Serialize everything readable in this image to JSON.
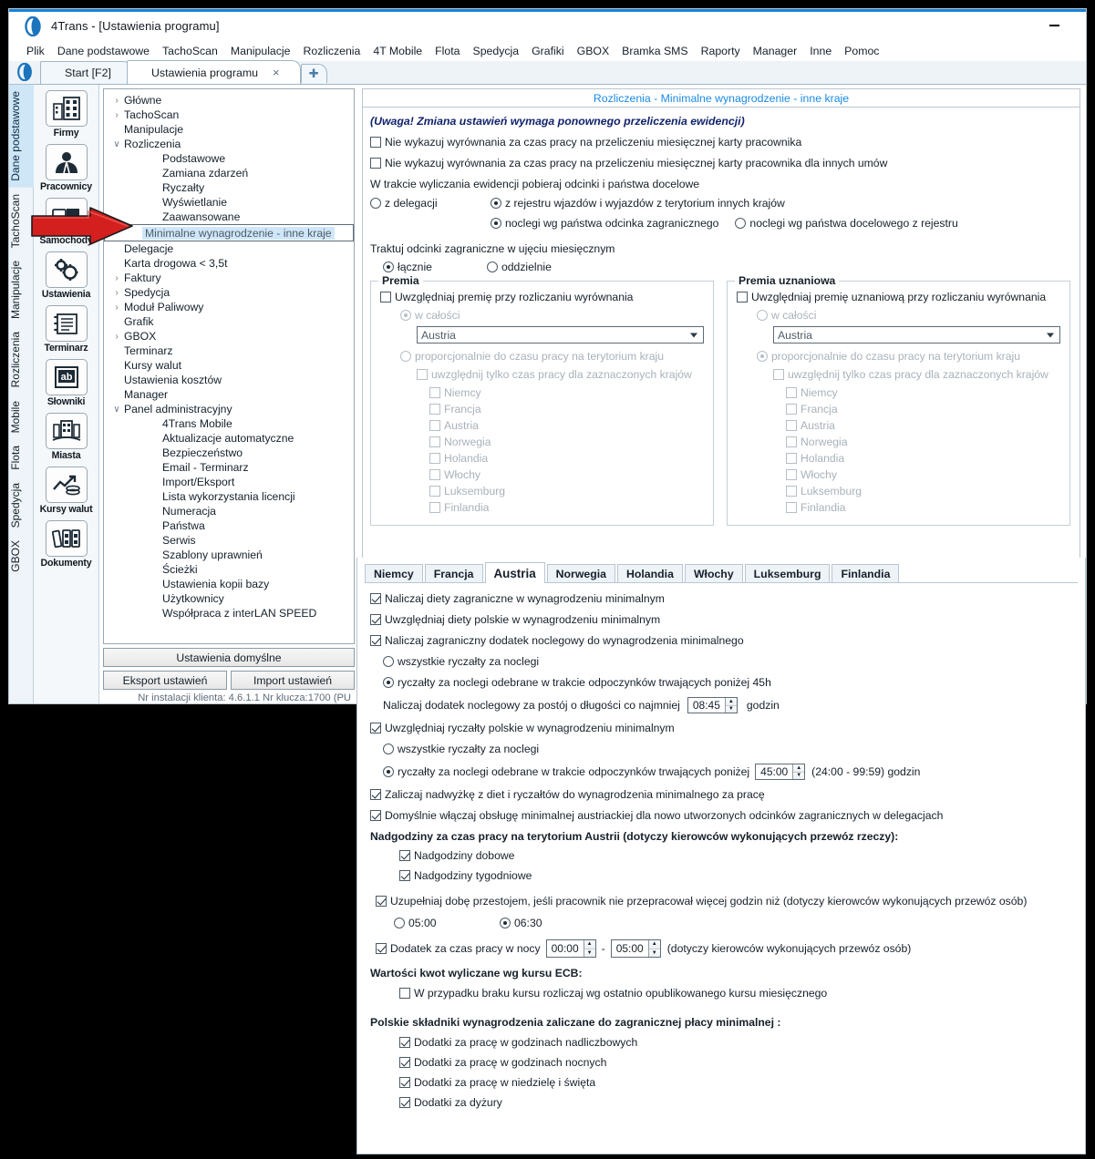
{
  "window": {
    "title": "4Trans - [Ustawienia programu]",
    "minimize_label": "minimize"
  },
  "menubar": {
    "items": [
      "Plik",
      "Dane podstawowe",
      "TachoScan",
      "Manipulacje",
      "Rozliczenia",
      "4T Mobile",
      "Flota",
      "Spedycja",
      "Grafiki",
      "GBOX",
      "Bramka SMS",
      "Raporty",
      "Manager",
      "Inne",
      "Pomoc"
    ]
  },
  "doctabs": {
    "tabs": [
      {
        "label": "Start [F2]",
        "active": false,
        "closable": false
      },
      {
        "label": "Ustawienia programu",
        "active": true,
        "closable": true,
        "close": "×"
      }
    ],
    "new_tab": "✚"
  },
  "rail": {
    "items": [
      {
        "label": "Dane podstawowe",
        "active": true
      },
      {
        "label": "TachoScan",
        "active": false
      },
      {
        "label": "Manipulacje",
        "active": false
      },
      {
        "label": "Rozliczenia",
        "active": false
      },
      {
        "label": "Mobile",
        "active": false
      },
      {
        "label": "Flota",
        "active": false
      },
      {
        "label": "Spedycja",
        "active": false
      },
      {
        "label": "GBOX",
        "active": false
      }
    ]
  },
  "iconbar": {
    "items": [
      {
        "label": "Firmy",
        "icon": "building-icon"
      },
      {
        "label": "Pracownicy",
        "icon": "person-icon"
      },
      {
        "label": "Samochody",
        "icon": "truck-icon"
      },
      {
        "label": "Ustawienia",
        "icon": "gears-icon"
      },
      {
        "label": "Terminarz",
        "icon": "calendar-icon"
      },
      {
        "label": "Słowniki",
        "icon": "book-ab-icon"
      },
      {
        "label": "Miasta",
        "icon": "city-icon"
      },
      {
        "label": "Kursy walut",
        "icon": "chart-coins-icon"
      },
      {
        "label": "Dokumenty",
        "icon": "binders-icon"
      }
    ]
  },
  "tree": {
    "nodes": [
      {
        "label": "Główne",
        "level": 1,
        "chevron": "›",
        "selected": false
      },
      {
        "label": "TachoScan",
        "level": 1,
        "chevron": "›",
        "selected": false
      },
      {
        "label": "Manipulacje",
        "level": 1,
        "chevron": "",
        "selected": false
      },
      {
        "label": "Rozliczenia",
        "level": 1,
        "chevron": "∨",
        "selected": false
      },
      {
        "label": "Podstawowe",
        "level": 2,
        "chevron": "",
        "selected": false
      },
      {
        "label": "Zamiana zdarzeń",
        "level": 2,
        "chevron": "",
        "selected": false
      },
      {
        "label": "Ryczałty",
        "level": 2,
        "chevron": "",
        "selected": false
      },
      {
        "label": "Wyświetlanie",
        "level": 2,
        "chevron": "",
        "selected": false
      },
      {
        "label": "Zaawansowane",
        "level": 2,
        "chevron": "",
        "selected": false
      },
      {
        "label": "Minimalne wynagrodzenie - inne kraje",
        "level": 2,
        "chevron": "",
        "selected": true
      },
      {
        "label": "Delegacje",
        "level": 1,
        "chevron": "",
        "selected": false
      },
      {
        "label": "Karta drogowa < 3,5t",
        "level": 1,
        "chevron": "",
        "selected": false
      },
      {
        "label": "Faktury",
        "level": 1,
        "chevron": "›",
        "selected": false
      },
      {
        "label": "Spedycja",
        "level": 1,
        "chevron": "›",
        "selected": false
      },
      {
        "label": "Moduł Paliwowy",
        "level": 1,
        "chevron": "›",
        "selected": false
      },
      {
        "label": "Grafik",
        "level": 1,
        "chevron": "",
        "selected": false
      },
      {
        "label": "GBOX",
        "level": 1,
        "chevron": "›",
        "selected": false
      },
      {
        "label": "Terminarz",
        "level": 1,
        "chevron": "",
        "selected": false
      },
      {
        "label": "Kursy walut",
        "level": 1,
        "chevron": "",
        "selected": false
      },
      {
        "label": "Ustawienia kosztów",
        "level": 1,
        "chevron": "",
        "selected": false
      },
      {
        "label": "Manager",
        "level": 1,
        "chevron": "",
        "selected": false
      },
      {
        "label": "Panel administracyjny",
        "level": 1,
        "chevron": "∨",
        "selected": false
      },
      {
        "label": "4Trans Mobile",
        "level": 2,
        "chevron": "",
        "selected": false
      },
      {
        "label": "Aktualizacje automatyczne",
        "level": 2,
        "chevron": "",
        "selected": false
      },
      {
        "label": "Bezpieczeństwo",
        "level": 2,
        "chevron": "",
        "selected": false
      },
      {
        "label": "Email - Terminarz",
        "level": 2,
        "chevron": "",
        "selected": false
      },
      {
        "label": "Import/Eksport",
        "level": 2,
        "chevron": "",
        "selected": false
      },
      {
        "label": "Lista wykorzystania licencji",
        "level": 2,
        "chevron": "",
        "selected": false
      },
      {
        "label": "Numeracja",
        "level": 2,
        "chevron": "",
        "selected": false
      },
      {
        "label": "Państwa",
        "level": 2,
        "chevron": "",
        "selected": false
      },
      {
        "label": "Serwis",
        "level": 2,
        "chevron": "",
        "selected": false
      },
      {
        "label": "Szablony uprawnień",
        "level": 2,
        "chevron": "",
        "selected": false
      },
      {
        "label": "Ścieżki",
        "level": 2,
        "chevron": "",
        "selected": false
      },
      {
        "label": "Ustawienia kopii bazy",
        "level": 2,
        "chevron": "",
        "selected": false
      },
      {
        "label": "Użytkownicy",
        "level": 2,
        "chevron": "",
        "selected": false
      },
      {
        "label": "Współpraca z interLAN SPEED",
        "level": 2,
        "chevron": "",
        "selected": false
      }
    ],
    "buttons": {
      "defaults": "Ustawienia domyślne",
      "export": "Eksport ustawień",
      "import": "Import ustawień"
    },
    "status": "Nr instalacji klienta: 4.6.1.1    Nr klucza:1700 (PU"
  },
  "page": {
    "title": "Rozliczenia - Minimalne wynagrodzenie - inne kraje",
    "warning": "(Uwaga! Zmiana ustawień wymaga ponownego przeliczenia ewidencji)",
    "check_no_balance_monthly": {
      "label": "Nie wykazuj wyrównania za czas pracy na przeliczeniu miesięcznej karty pracownika",
      "checked": false
    },
    "check_no_balance_other": {
      "label": "Nie wykazuj wyrównania za czas pracy na przeliczeniu miesięcznej karty pracownika dla innych umów",
      "checked": false
    },
    "fetch_label": "W trakcie wyliczania ewidencji pobieraj odcinki i państwa docelowe",
    "fetch_options": [
      {
        "label": "z delegacji",
        "checked": false
      },
      {
        "label": "z rejestru wjazdów i wyjazdów z terytorium innych krajów",
        "checked": true
      }
    ],
    "lodging_options": [
      {
        "label": "noclegi wg państwa odcinka zagranicznego",
        "checked": true
      },
      {
        "label": "noclegi wg państwa docelowego z rejestru",
        "checked": false
      }
    ],
    "monthly_label": "Traktuj odcinki zagraniczne w ujęciu miesięcznym",
    "monthly_options": [
      {
        "label": "łącznie",
        "checked": true
      },
      {
        "label": "oddzielnie",
        "checked": false
      }
    ]
  },
  "premia": {
    "legend": "Premia",
    "enable": {
      "label": "Uwzględniaj premię przy rozliczaniu wyrównania",
      "checked": false
    },
    "mode_full": {
      "label": "w całości",
      "checked": true,
      "disabled": true
    },
    "country_select": {
      "value": "Austria",
      "disabled": true
    },
    "mode_proportional": {
      "label": "proporcjonalnie do czasu pracy na terytorium kraju",
      "checked": false,
      "disabled": true
    },
    "only_selected": {
      "label": "uwzględnij tylko czas pracy dla zaznaczonych krajów",
      "checked": false,
      "disabled": true
    },
    "countries": [
      {
        "label": "Niemcy",
        "checked": false
      },
      {
        "label": "Francja",
        "checked": false
      },
      {
        "label": "Austria",
        "checked": false
      },
      {
        "label": "Norwegia",
        "checked": false
      },
      {
        "label": "Holandia",
        "checked": false
      },
      {
        "label": "Włochy",
        "checked": false
      },
      {
        "label": "Luksemburg",
        "checked": false
      },
      {
        "label": "Finlandia",
        "checked": false
      }
    ]
  },
  "premia_uznaniowa": {
    "legend": "Premia uznaniowa",
    "enable": {
      "label": "Uwzględniaj premię uznaniową przy rozliczaniu wyrównania",
      "checked": false
    },
    "mode_full": {
      "label": "w całości",
      "checked": false,
      "disabled": true
    },
    "country_select": {
      "value": "Austria",
      "disabled": true
    },
    "mode_proportional": {
      "label": "proporcjonalnie do czasu pracy na terytorium kraju",
      "checked": true,
      "disabled": true
    },
    "only_selected": {
      "label": "uwzględnij tylko czas pracy dla zaznaczonych krajów",
      "checked": false,
      "disabled": true
    },
    "countries": [
      {
        "label": "Niemcy",
        "checked": false
      },
      {
        "label": "Francja",
        "checked": false
      },
      {
        "label": "Austria",
        "checked": false
      },
      {
        "label": "Norwegia",
        "checked": false
      },
      {
        "label": "Holandia",
        "checked": false
      },
      {
        "label": "Włochy",
        "checked": false
      },
      {
        "label": "Luksemburg",
        "checked": false
      },
      {
        "label": "Finlandia",
        "checked": false
      }
    ]
  },
  "country_tabs": {
    "tabs": [
      {
        "label": "Niemcy",
        "active": false
      },
      {
        "label": "Francja",
        "active": false
      },
      {
        "label": "Austria",
        "active": true
      },
      {
        "label": "Norwegia",
        "active": false
      },
      {
        "label": "Holandia",
        "active": false
      },
      {
        "label": "Włochy",
        "active": false
      },
      {
        "label": "Luksemburg",
        "active": false
      },
      {
        "label": "Finlandia",
        "active": false
      }
    ]
  },
  "austria": {
    "c1": {
      "label": "Naliczaj diety zagraniczne w wynagrodzeniu minimalnym",
      "checked": true
    },
    "c2": {
      "label": "Uwzględniaj diety polskie w wynagrodzeniu minimalnym",
      "checked": true
    },
    "c3": {
      "label": "Naliczaj zagraniczny dodatek noclegowy do wynagrodzenia minimalnego",
      "checked": true
    },
    "r1": {
      "label": "wszystkie ryczałty za noclegi",
      "checked": false
    },
    "r2": {
      "label": "ryczałty za noclegi odebrane w trakcie odpoczynków trwających poniżej 45h",
      "checked": true
    },
    "stop_label": "Naliczaj dodatek noclegowy za postój o długości co najmniej",
    "stop_value": "08:45",
    "stop_unit": "godzin",
    "c4": {
      "label": "Uwzględniaj ryczałty polskie w wynagrodzeniu minimalnym",
      "checked": true
    },
    "r3": {
      "label": "wszystkie ryczałty za noclegi",
      "checked": false
    },
    "r4": {
      "label": "ryczałty za noclegi odebrane w trakcie odpoczynków trwających poniżej",
      "checked": true
    },
    "r4_value": "45:00",
    "r4_hint": "(24:00 - 99:59) godzin",
    "c5": {
      "label": "Zaliczaj nadwyżkę z diet i ryczałtów do wynagrodzenia minimalnego za pracę",
      "checked": true
    },
    "c6": {
      "label": "Domyślnie włączaj obsługę minimalnej austriackiej dla nowo utworzonych odcinków zagranicznych w delegacjach",
      "checked": true
    },
    "overtime_header": "Nadgodziny za czas pracy na terytorium Austrii (dotyczy kierowców wykonujących przewóz rzeczy):",
    "ot_daily": {
      "label": "Nadgodziny dobowe",
      "checked": true
    },
    "ot_weekly": {
      "label": "Nadgodziny tygodniowe",
      "checked": true
    },
    "c7": {
      "label": "Uzupełniaj dobę przestojem, jeśli pracownik nie przepracował więcej godzin niż (dotyczy kierowców wykonujących przewóz osób)",
      "checked": true
    },
    "day_options": [
      {
        "label": "05:00",
        "checked": false
      },
      {
        "label": "06:30",
        "checked": true
      }
    ],
    "night": {
      "label": "Dodatek za czas pracy w nocy",
      "checked": true,
      "from": "00:00",
      "dash": "-",
      "to": "05:00",
      "hint": "(dotyczy kierowców wykonujących przewóz osób)"
    },
    "ecb_header": "Wartości kwot wyliczane wg kursu ECB:",
    "ecb_check": {
      "label": "W przypadku braku kursu rozliczaj wg ostatnio opublikowanego kursu miesięcznego",
      "checked": false
    },
    "pl_header": "Polskie składniki wynagrodzenia zaliczane do zagranicznej płacy minimalnej :",
    "pl_items": [
      {
        "label": "Dodatki za pracę w godzinach nadliczbowych",
        "checked": true
      },
      {
        "label": "Dodatki za pracę w godzinach nocnych",
        "checked": true
      },
      {
        "label": "Dodatki za pracę w niedzielę i święta",
        "checked": true
      },
      {
        "label": "Dodatki za dyżury",
        "checked": true
      }
    ]
  },
  "annotation": {
    "arrow_color": "#d41f1f",
    "target": "Minimalne wynagrodzenie - inne kraje"
  }
}
